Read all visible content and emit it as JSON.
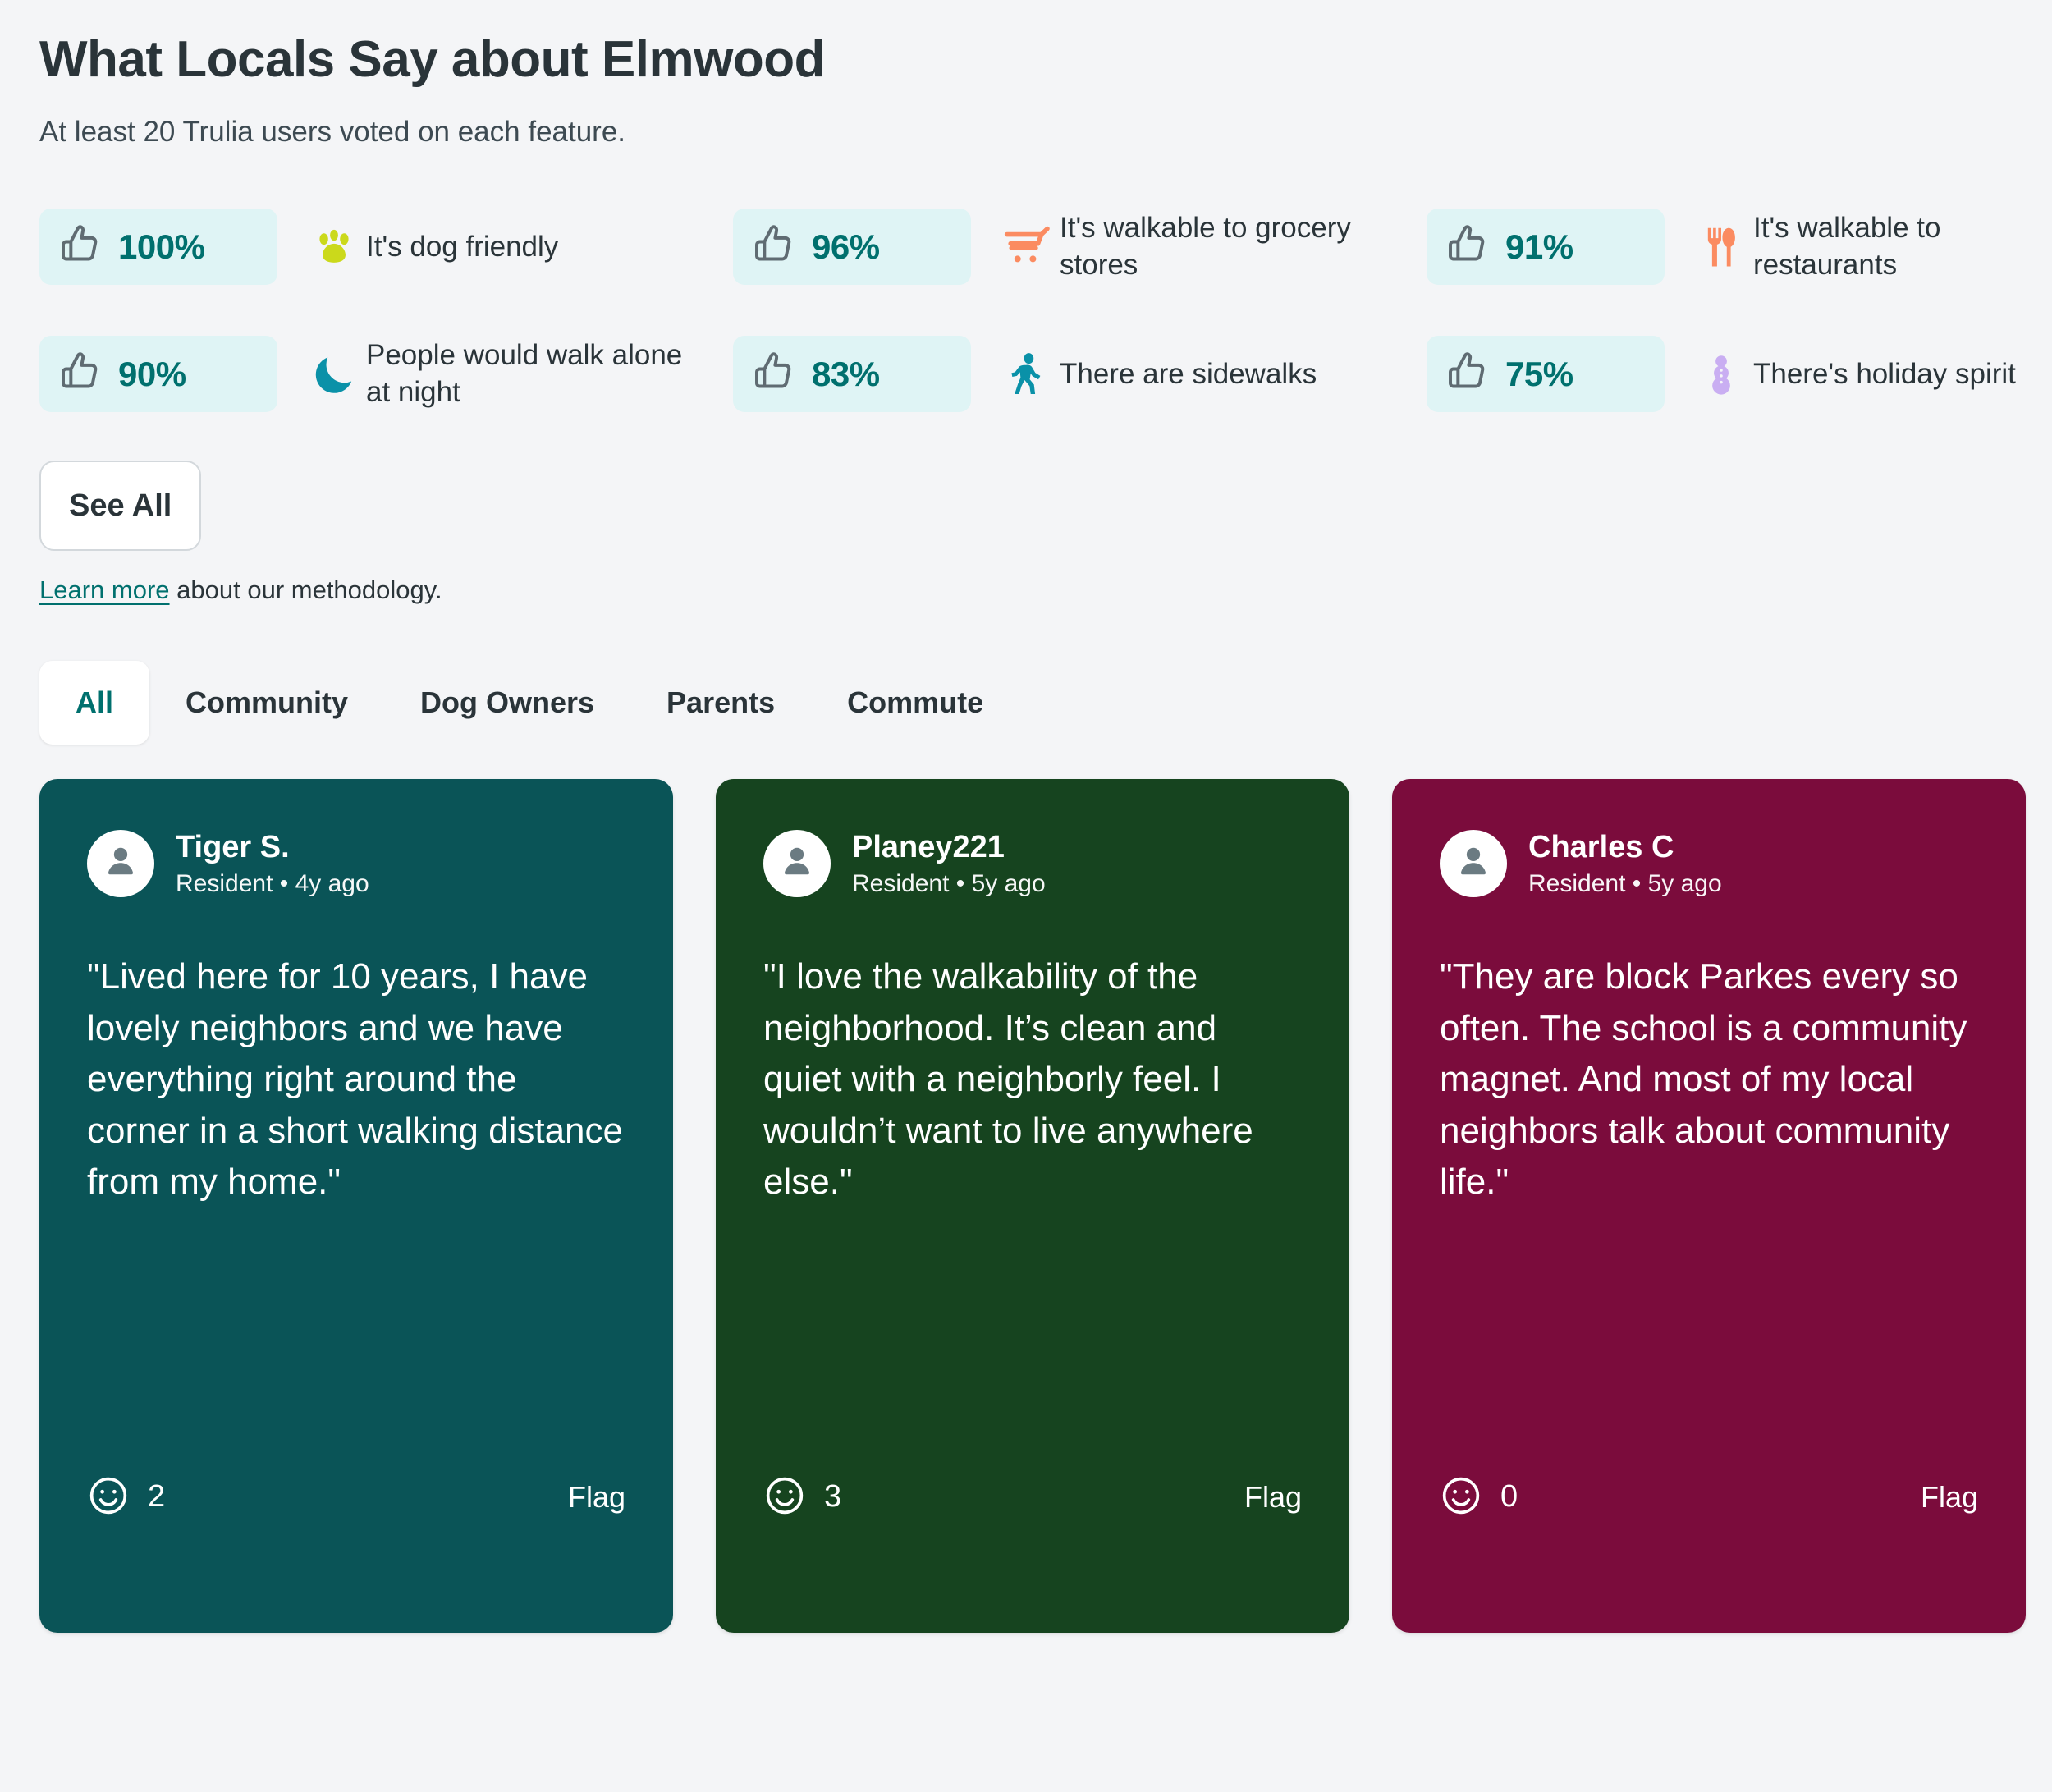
{
  "header": {
    "title": "What Locals Say about Elmwood",
    "subtitle": "At least 20 Trulia users voted on each feature."
  },
  "features": [
    {
      "percent": "100%",
      "label": "It's dog friendly",
      "icon": "paw-print-icon",
      "icon_color": "#cbd91b"
    },
    {
      "percent": "96%",
      "label": "It's walkable to grocery stores",
      "icon": "shopping-cart-icon",
      "icon_color": "#fb8b61"
    },
    {
      "percent": "91%",
      "label": "It's walkable to restaurants",
      "icon": "fork-knife-icon",
      "icon_color": "#fb8b61"
    },
    {
      "percent": "90%",
      "label": "People would walk alone at night",
      "icon": "crescent-moon-icon",
      "icon_color": "#0a91a8"
    },
    {
      "percent": "83%",
      "label": "There are sidewalks",
      "icon": "walking-person-icon",
      "icon_color": "#0a91a8"
    },
    {
      "percent": "75%",
      "label": "There's holiday spirit",
      "icon": "snowman-icon",
      "icon_color": "#c9aef2"
    }
  ],
  "see_all_label": "See All",
  "methodology": {
    "link_text": "Learn more",
    "rest_text": " about our methodology."
  },
  "tabs": [
    {
      "label": "All",
      "active": true
    },
    {
      "label": "Community",
      "active": false
    },
    {
      "label": "Dog Owners",
      "active": false
    },
    {
      "label": "Parents",
      "active": false
    },
    {
      "label": "Commute",
      "active": false
    }
  ],
  "reviews": [
    {
      "author": "Tiger S.",
      "meta": "Resident • 4y ago",
      "quote": "\"Lived here for 10 years, I have lovely neighbors and we have everything right around the corner in a short walking distance from my home.\"",
      "reaction_count": "2",
      "flag_label": "Flag",
      "bg_color": "#0a5457"
    },
    {
      "author": "Planey221",
      "meta": "Resident • 5y ago",
      "quote": "\"I love the walkability of the neighborhood. It’s clean and quiet with a neighborly feel. I wouldn’t want to live anywhere else.\"",
      "reaction_count": "3",
      "flag_label": "Flag",
      "bg_color": "#16441f"
    },
    {
      "author": "Charles C",
      "meta": "Resident • 5y ago",
      "quote": "\"They are block Parkes every so often. The school is a community magnet. And most of my local neighbors talk about community life.\"",
      "reaction_count": "0",
      "flag_label": "Flag",
      "bg_color": "#7b0c3c"
    }
  ],
  "colors": {
    "page_bg": "#f4f5f7",
    "pill_bg": "#dff4f5",
    "accent_teal": "#00706e",
    "thumb_gray": "#5f6b72",
    "title": "#2a3439"
  }
}
